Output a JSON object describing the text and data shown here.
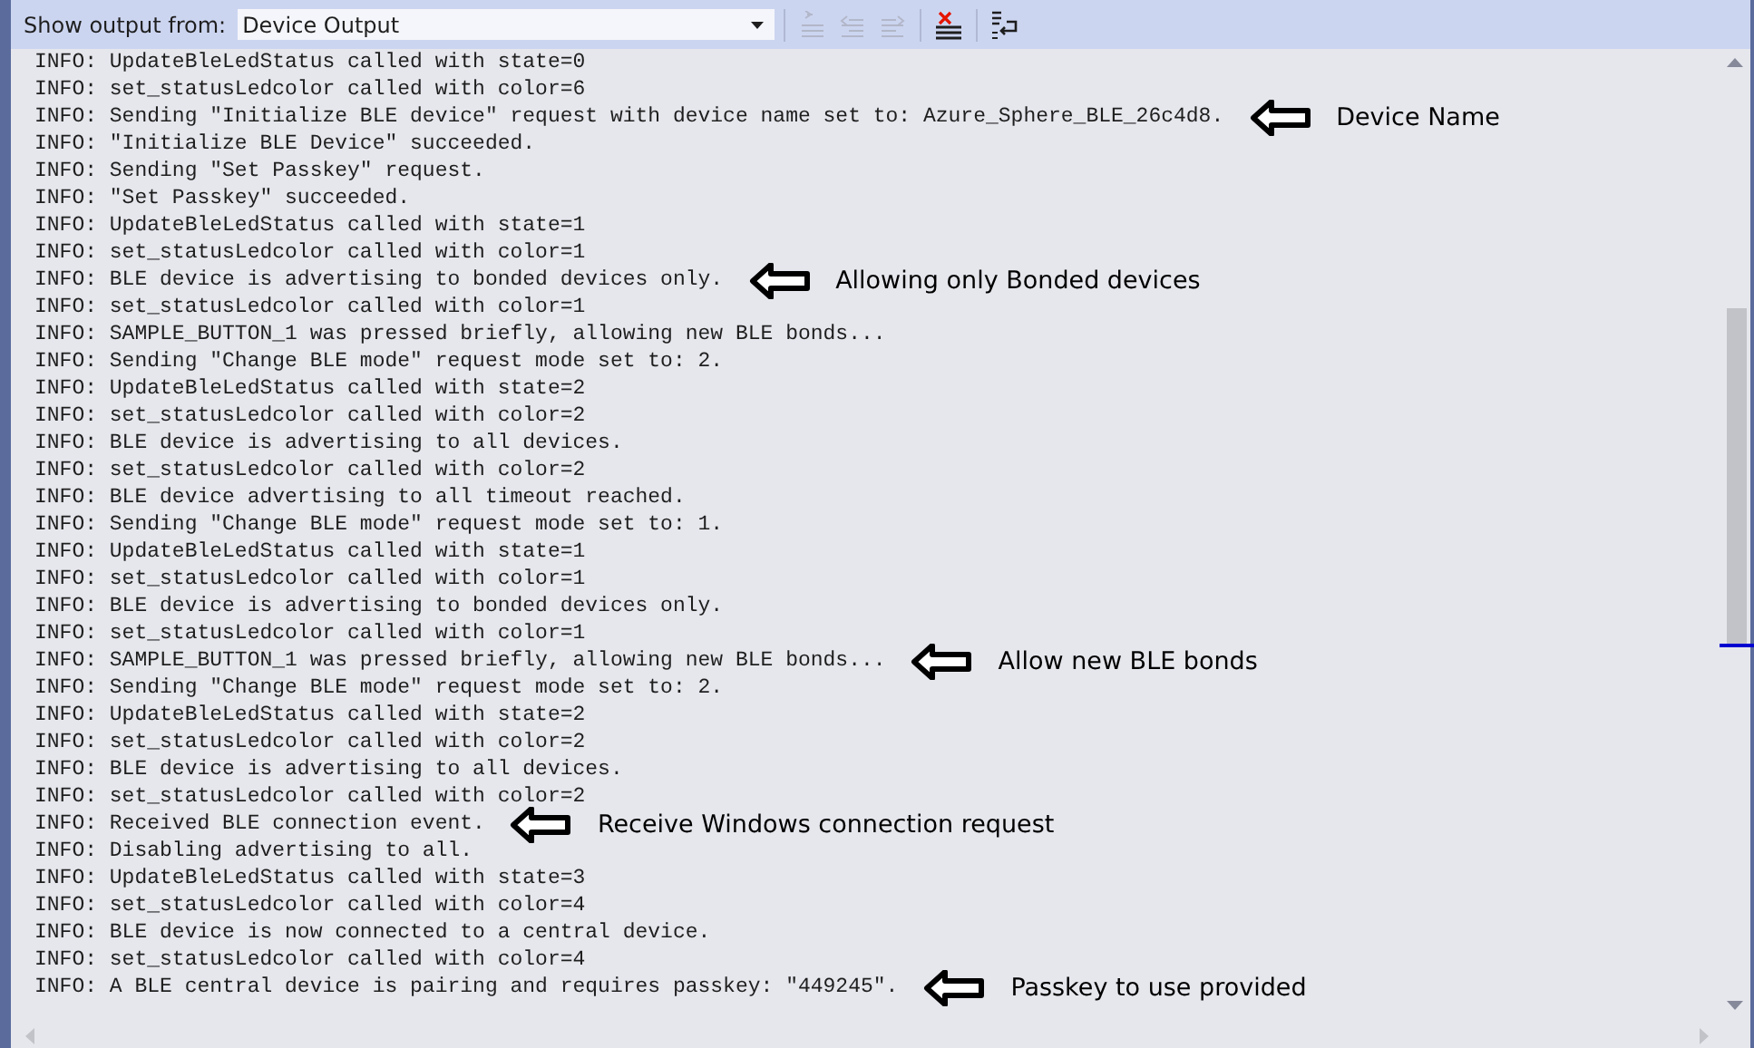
{
  "toolbar": {
    "label": "Show output from:",
    "source": {
      "value": "Device Output"
    },
    "buttons": [
      {
        "kind": "find",
        "disabled": true
      },
      {
        "kind": "previous",
        "disabled": true
      },
      {
        "kind": "next",
        "disabled": true
      },
      {
        "kind": "clear",
        "disabled": false
      },
      {
        "kind": "wrap",
        "disabled": false
      }
    ]
  },
  "output": {
    "lines": [
      {
        "text": "INFO: UpdateBleLedStatus called with state=0"
      },
      {
        "text": "INFO: set_statusLedcolor called with color=6"
      },
      {
        "text": "INFO: Sending \"Initialize BLE device\" request with device name set to: Azure_Sphere_BLE_26c4d8.",
        "note": "Device Name"
      },
      {
        "text": "INFO: \"Initialize BLE Device\" succeeded."
      },
      {
        "text": "INFO: Sending \"Set Passkey\" request."
      },
      {
        "text": "INFO: \"Set Passkey\" succeeded."
      },
      {
        "text": "INFO: UpdateBleLedStatus called with state=1"
      },
      {
        "text": "INFO: set_statusLedcolor called with color=1"
      },
      {
        "text": "INFO: BLE device is advertising to bonded devices only.",
        "note": "Allowing only Bonded devices"
      },
      {
        "text": "INFO: set_statusLedcolor called with color=1"
      },
      {
        "text": "INFO: SAMPLE_BUTTON_1 was pressed briefly, allowing new BLE bonds..."
      },
      {
        "text": "INFO: Sending \"Change BLE mode\" request mode set to: 2."
      },
      {
        "text": "INFO: UpdateBleLedStatus called with state=2"
      },
      {
        "text": "INFO: set_statusLedcolor called with color=2"
      },
      {
        "text": "INFO: BLE device is advertising to all devices."
      },
      {
        "text": "INFO: set_statusLedcolor called with color=2"
      },
      {
        "text": "INFO: BLE device advertising to all timeout reached."
      },
      {
        "text": "INFO: Sending \"Change BLE mode\" request mode set to: 1."
      },
      {
        "text": "INFO: UpdateBleLedStatus called with state=1"
      },
      {
        "text": "INFO: set_statusLedcolor called with color=1"
      },
      {
        "text": "INFO: BLE device is advertising to bonded devices only."
      },
      {
        "text": "INFO: set_statusLedcolor called with color=1"
      },
      {
        "text": "INFO: SAMPLE_BUTTON_1 was pressed briefly, allowing new BLE bonds...",
        "note": "Allow new BLE bonds"
      },
      {
        "text": "INFO: Sending \"Change BLE mode\" request mode set to: 2."
      },
      {
        "text": "INFO: UpdateBleLedStatus called with state=2"
      },
      {
        "text": "INFO: set_statusLedcolor called with color=2"
      },
      {
        "text": "INFO: BLE device is advertising to all devices."
      },
      {
        "text": "INFO: set_statusLedcolor called with color=2"
      },
      {
        "text": "INFO: Received BLE connection event.",
        "note": "Receive Windows connection request"
      },
      {
        "text": "INFO: Disabling advertising to all."
      },
      {
        "text": "INFO: UpdateBleLedStatus called with state=3"
      },
      {
        "text": "INFO: set_statusLedcolor called with color=4"
      },
      {
        "text": "INFO: BLE device is now connected to a central device."
      },
      {
        "text": "INFO: set_statusLedcolor called with color=4"
      },
      {
        "text": "INFO: A BLE central device is pairing and requires passkey: \"449245\".",
        "note": "Passkey to use provided"
      }
    ]
  }
}
